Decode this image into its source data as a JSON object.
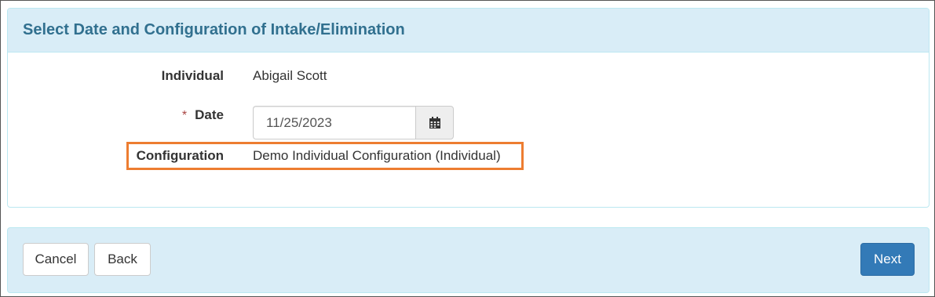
{
  "panel": {
    "title": "Select Date and Configuration of Intake/Elimination"
  },
  "form": {
    "individual": {
      "label": "Individual",
      "value": "Abigail Scott"
    },
    "date": {
      "required_marker": "*",
      "label": "Date",
      "value": "11/25/2023",
      "icon": "calendar-icon"
    },
    "configuration": {
      "label": "Configuration",
      "value": "Demo Individual Configuration (Individual)"
    }
  },
  "highlight_color": "#ed7d31",
  "footer": {
    "cancel_label": "Cancel",
    "back_label": "Back",
    "next_label": "Next"
  },
  "colors": {
    "heading_bg": "#d9edf7",
    "heading_text": "#31708f",
    "primary": "#337ab7",
    "required": "#a94442"
  }
}
